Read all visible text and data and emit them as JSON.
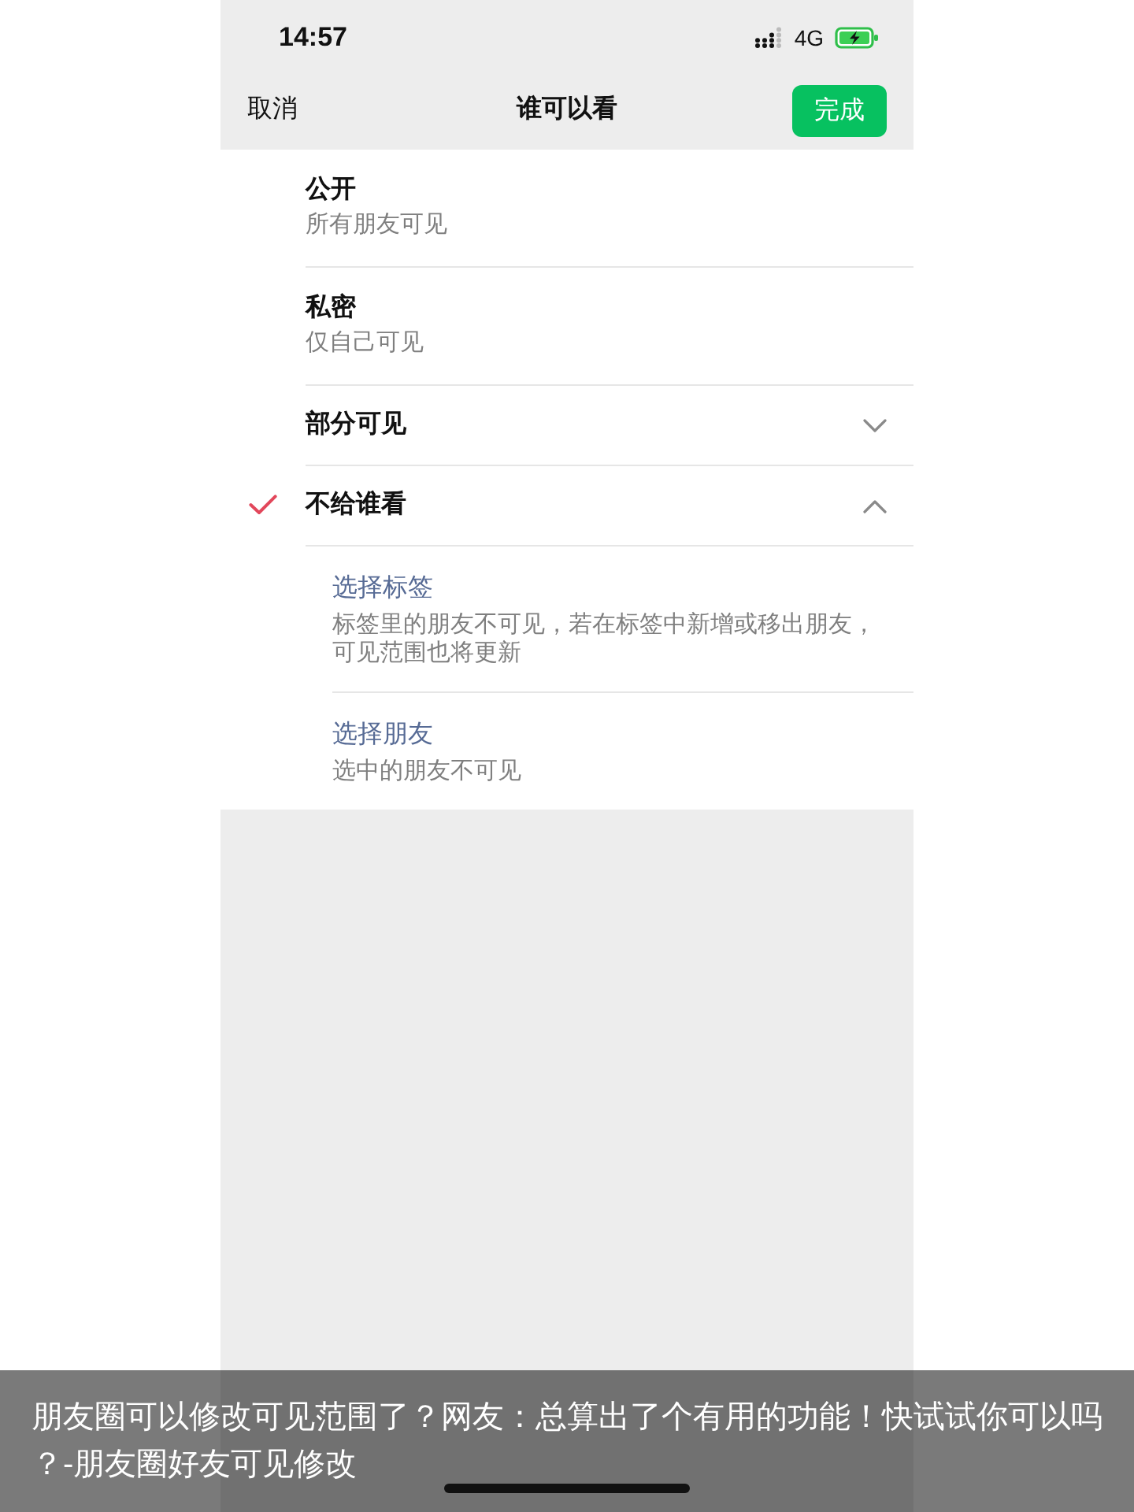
{
  "status_bar": {
    "time": "14:57",
    "network": "4G"
  },
  "nav_bar": {
    "cancel": "取消",
    "title": "谁可以看",
    "done": "完成"
  },
  "options": [
    {
      "kind": "plain",
      "title": "公开",
      "subtitle": "所有朋友可见",
      "selected": false
    },
    {
      "kind": "plain",
      "title": "私密",
      "subtitle": "仅自己可见",
      "selected": false
    },
    {
      "kind": "expandable",
      "title": "部分可见",
      "selected": false,
      "expanded": false
    },
    {
      "kind": "expandable",
      "title": "不给谁看",
      "selected": true,
      "expanded": true,
      "children": [
        {
          "title": "选择标签",
          "subtitle": "标签里的朋友不可见，若在标签中新增或移出朋友，可见范围也将更新"
        },
        {
          "title": "选择朋友",
          "subtitle": "选中的朋友不可见"
        }
      ]
    }
  ],
  "caption": "朋友圈可以修改可见范围了？网友：总算出了个有用的功能！快试试你可以吗？-朋友圈好友可见修改"
}
